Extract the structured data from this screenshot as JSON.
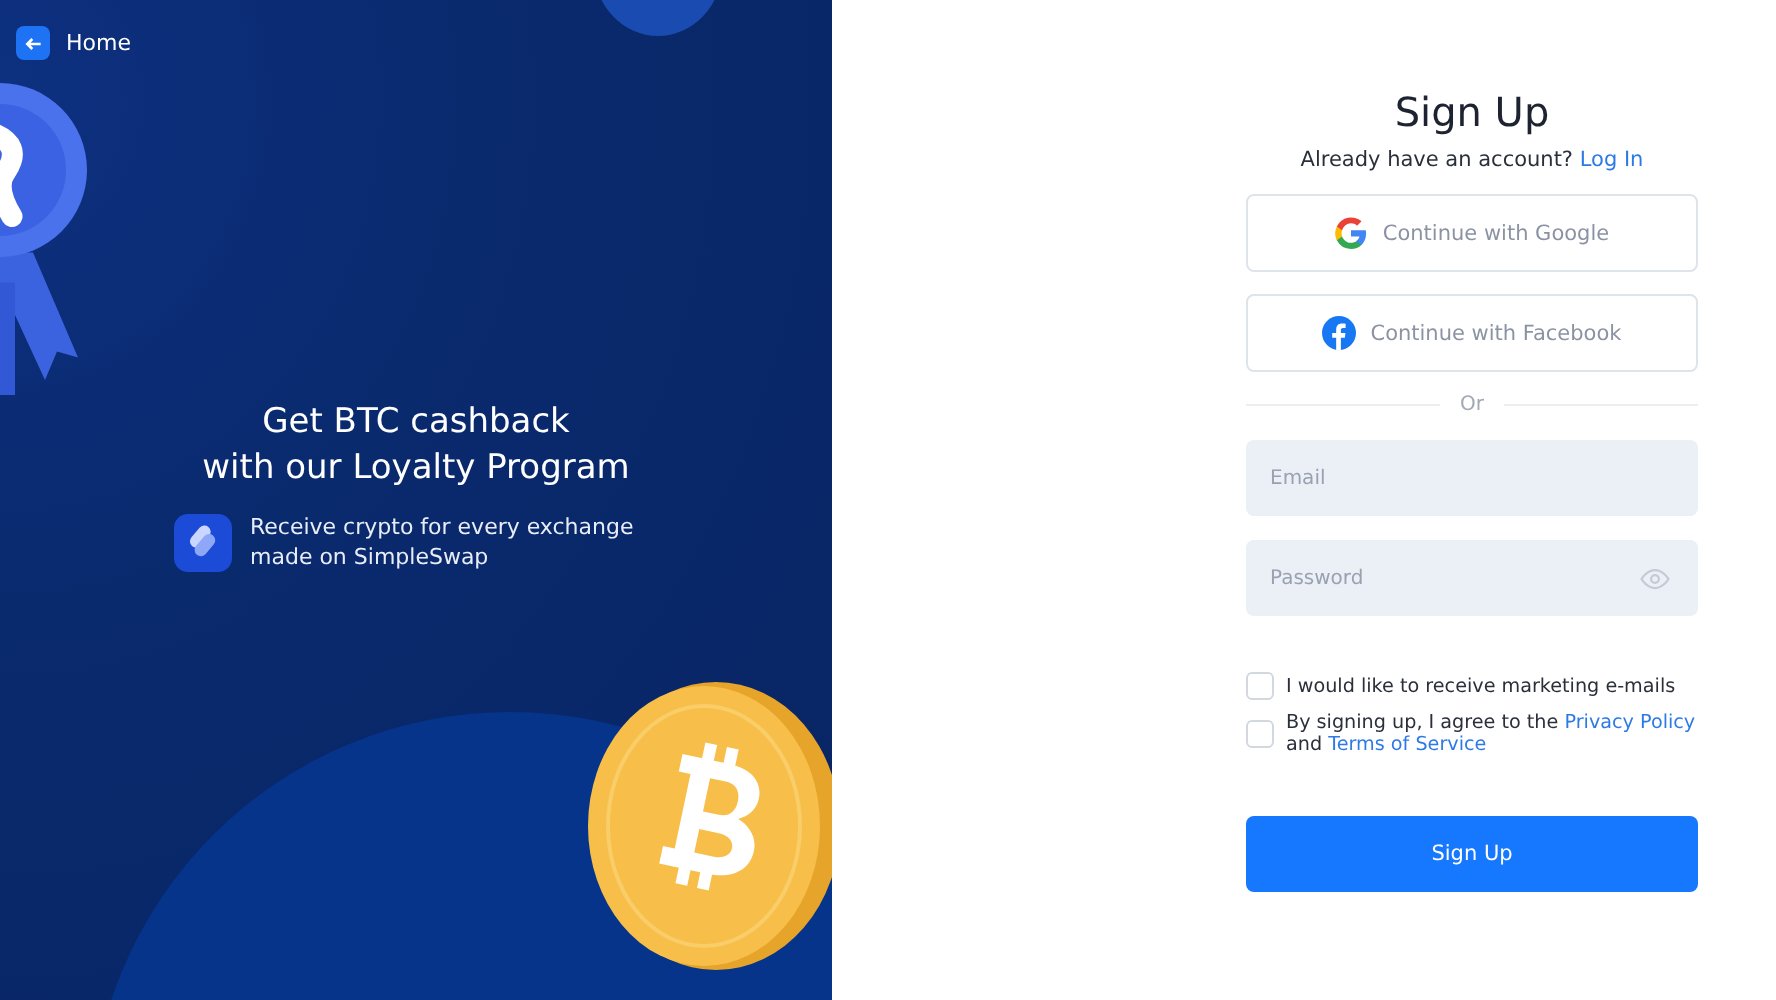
{
  "promo": {
    "home_link": "Home",
    "headline_lines": [
      "Get BTC cashback",
      "with our Loyalty Program"
    ],
    "feature_text": "Receive crypto for every exchange made on SimpleSwap"
  },
  "signup": {
    "title": "Sign Up",
    "login_prompt": "Already have an account?",
    "login_link": "Log In",
    "social_buttons": [
      {
        "kind": "google",
        "label": "Continue with Google"
      },
      {
        "kind": "facebook",
        "label": "Continue with Facebook"
      }
    ],
    "divider": "Or",
    "fields": [
      {
        "kind": "email",
        "placeholder": "Email"
      },
      {
        "kind": "password",
        "placeholder": "Password"
      }
    ],
    "marketing_checkbox": {
      "checked": false,
      "label": "I would like to receive marketing e-mails"
    },
    "terms_checkbox": {
      "checked": false,
      "text_before": "By signing up, I agree to the",
      "privacy_link": "Privacy Policy",
      "text_middle": "and",
      "terms_link": "Terms of Service"
    },
    "submit": "Sign Up"
  }
}
